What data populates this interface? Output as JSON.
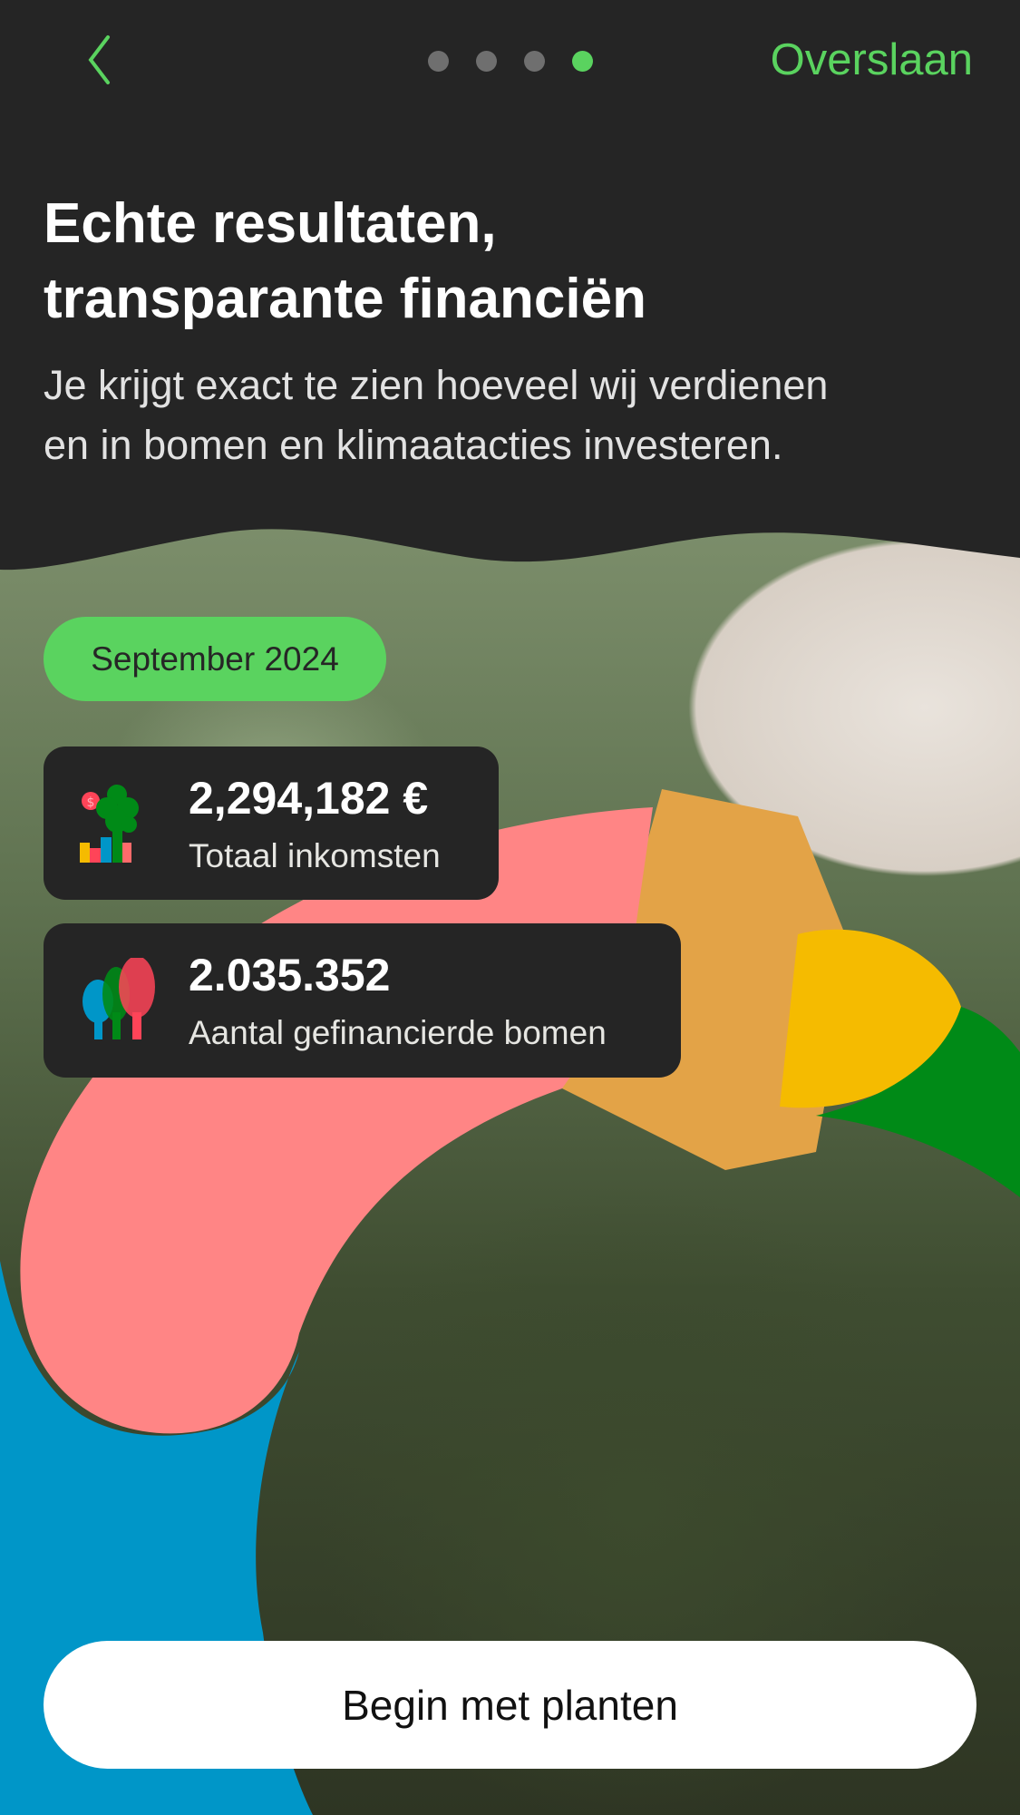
{
  "nav": {
    "back_icon": "chevron-left-icon",
    "skip_label": "Overslaan",
    "page_count": 4,
    "active_page": 4
  },
  "header": {
    "title_line1": "Echte resultaten,",
    "title_line2": "transparante financiën",
    "subtitle_line1": "Je krijgt exact te zien hoeveel wij verdienen",
    "subtitle_line2": "en in bomen en klimaatacties investeren."
  },
  "period_badge": "September 2024",
  "stats": [
    {
      "value": "2,294,182 €",
      "label": "Totaal inkomsten",
      "icon": "income-tree-chart-icon"
    },
    {
      "value": "2.035.352",
      "label": "Aantal gefinancierde bomen",
      "icon": "trees-icon"
    }
  ],
  "cta_label": "Begin met planten",
  "colors": {
    "accent": "#5ad35f",
    "background": "#252525",
    "pink": "#ff8585",
    "blue": "#0096c8",
    "yellow": "#f5bb00",
    "green": "#008a17"
  }
}
